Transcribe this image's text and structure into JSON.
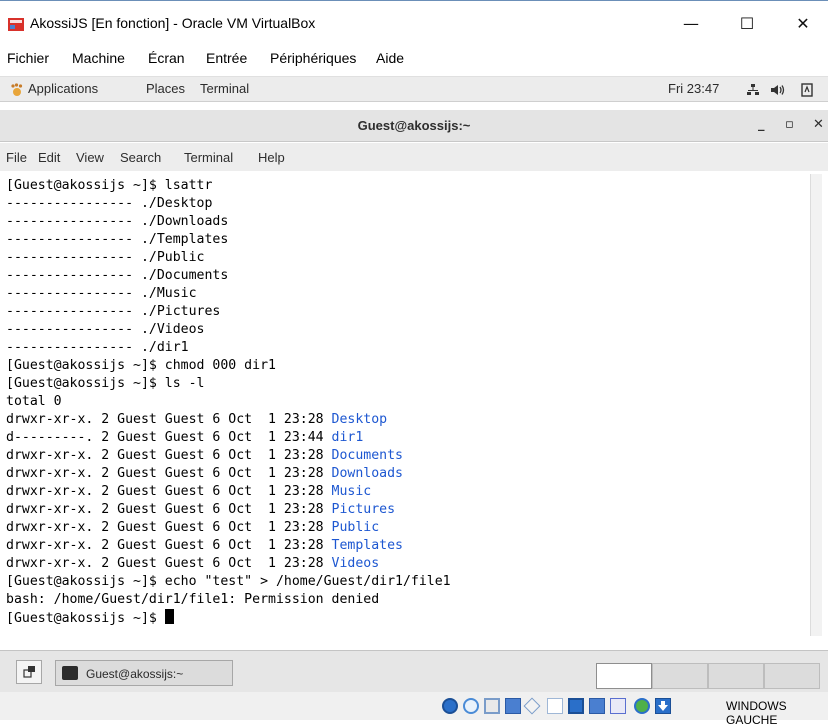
{
  "window": {
    "title": "AkossiJS [En fonction] - Oracle VM VirtualBox",
    "controls": {
      "minimize": "—",
      "maximize": "☐",
      "close": "✕"
    }
  },
  "vbox_menu": [
    "Fichier",
    "Machine",
    "Écran",
    "Entrée",
    "Périphériques",
    "Aide"
  ],
  "gnome_bar": {
    "applications": "Applications",
    "places": "Places",
    "terminal": "Terminal",
    "clock": "Fri 23:47"
  },
  "terminal": {
    "title": "Guest@akossijs:~",
    "controls": {
      "minimize": "_",
      "maximize": "▫",
      "close": "✕"
    },
    "menu": [
      "File",
      "Edit",
      "View",
      "Search",
      "Terminal",
      "Help"
    ],
    "lines": [
      {
        "text": "[Guest@akossijs ~]$ lsattr"
      },
      {
        "text": "---------------- ./Desktop"
      },
      {
        "text": "---------------- ./Downloads"
      },
      {
        "text": "---------------- ./Templates"
      },
      {
        "text": "---------------- ./Public"
      },
      {
        "text": "---------------- ./Documents"
      },
      {
        "text": "---------------- ./Music"
      },
      {
        "text": "---------------- ./Pictures"
      },
      {
        "text": "---------------- ./Videos"
      },
      {
        "text": "---------------- ./dir1"
      },
      {
        "text": "[Guest@akossijs ~]$ chmod 000 dir1"
      },
      {
        "text": "[Guest@akossijs ~]$ ls -l"
      },
      {
        "text": "total 0"
      },
      {
        "text": "drwxr-xr-x. 2 Guest Guest 6 Oct  1 23:28 ",
        "name": "Desktop"
      },
      {
        "text": "d---------. 2 Guest Guest 6 Oct  1 23:44 ",
        "name": "dir1"
      },
      {
        "text": "drwxr-xr-x. 2 Guest Guest 6 Oct  1 23:28 ",
        "name": "Documents"
      },
      {
        "text": "drwxr-xr-x. 2 Guest Guest 6 Oct  1 23:28 ",
        "name": "Downloads"
      },
      {
        "text": "drwxr-xr-x. 2 Guest Guest 6 Oct  1 23:28 ",
        "name": "Music"
      },
      {
        "text": "drwxr-xr-x. 2 Guest Guest 6 Oct  1 23:28 ",
        "name": "Pictures"
      },
      {
        "text": "drwxr-xr-x. 2 Guest Guest 6 Oct  1 23:28 ",
        "name": "Public"
      },
      {
        "text": "drwxr-xr-x. 2 Guest Guest 6 Oct  1 23:28 ",
        "name": "Templates"
      },
      {
        "text": "drwxr-xr-x. 2 Guest Guest 6 Oct  1 23:28 ",
        "name": "Videos"
      },
      {
        "text": "[Guest@akossijs ~]$ echo \"test\" > /home/Guest/dir1/file1"
      },
      {
        "text": "bash: /home/Guest/dir1/file1: Permission denied"
      },
      {
        "text": "[Guest@akossijs ~]$ ",
        "cursor": true
      }
    ]
  },
  "taskbar": {
    "window_button": "Guest@akossijs:~"
  },
  "vbox_status": {
    "host_key": "WINDOWS GAUCHE"
  },
  "colors": {
    "directory": "#1d57d1",
    "vbox_icon": "#d8312b"
  }
}
